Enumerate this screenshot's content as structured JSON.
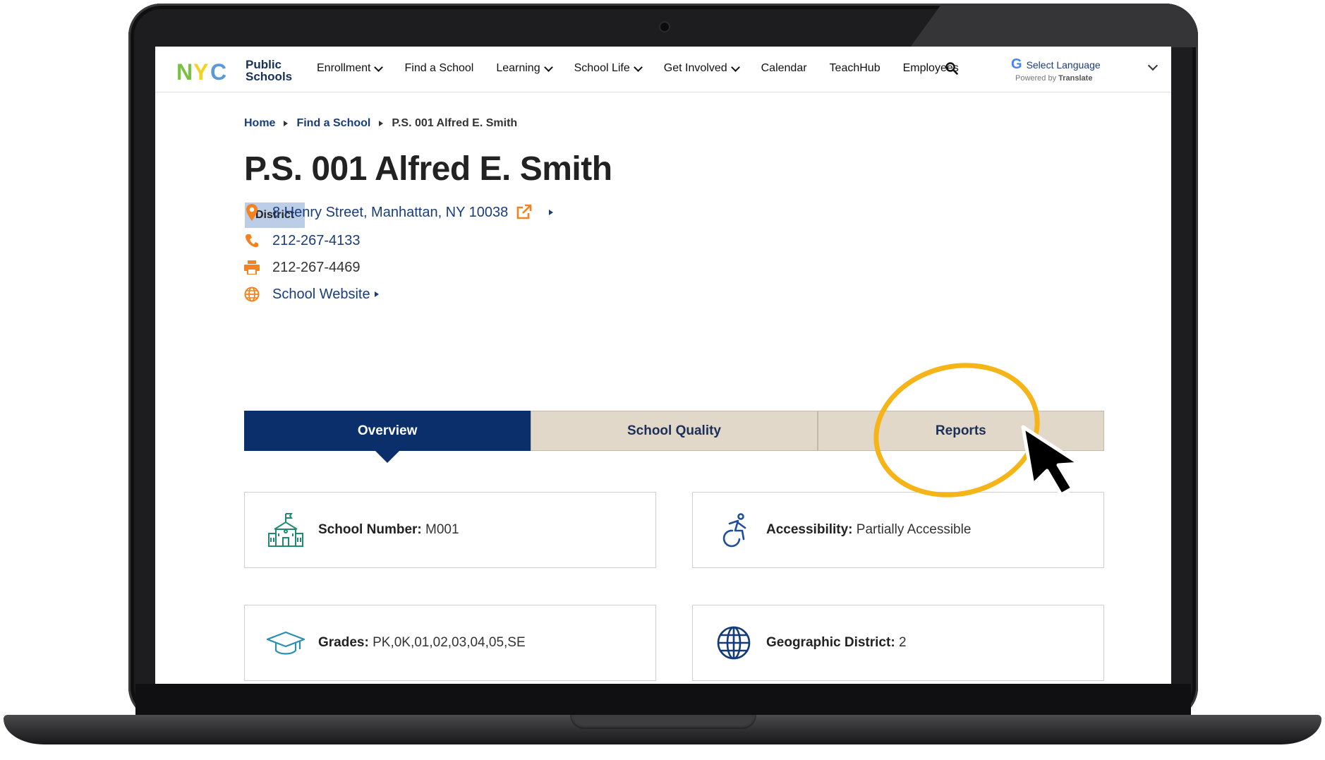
{
  "header": {
    "logo": {
      "mark": "NYC",
      "line1": "Public",
      "line2": "Schools"
    },
    "nav": [
      {
        "label": "Enrollment",
        "dropdown": true
      },
      {
        "label": "Find a School",
        "dropdown": false
      },
      {
        "label": "Learning",
        "dropdown": true
      },
      {
        "label": "School Life",
        "dropdown": true
      },
      {
        "label": "Get Involved",
        "dropdown": true
      },
      {
        "label": "Calendar",
        "dropdown": false
      },
      {
        "label": "TeachHub",
        "dropdown": false
      },
      {
        "label": "Employees",
        "dropdown": false
      }
    ],
    "search_icon": "search-icon",
    "language": {
      "g": "G",
      "label": "Select Language",
      "powered_prefix": "Powered by",
      "powered_brand": "Translate"
    }
  },
  "breadcrumb": {
    "home": "Home",
    "find": "Find a School",
    "current": "P.S. 001 Alfred E. Smith"
  },
  "school": {
    "name": "P.S. 001 Alfred E. Smith",
    "badge": "District",
    "address": "8 Henry Street, Manhattan, NY 10038",
    "phone": "212-267-4133",
    "fax": "212-267-4469",
    "website": "School Website"
  },
  "tabs": {
    "overview": "Overview",
    "quality": "School Quality",
    "reports": "Reports",
    "active": "Overview"
  },
  "cards": {
    "school_number": {
      "label": "School Number:",
      "value": "M001"
    },
    "accessibility": {
      "label": "Accessibility:",
      "value": "Partially Accessible"
    },
    "grades": {
      "label": "Grades:",
      "value": "PK,0K,01,02,03,04,05,SE"
    },
    "district": {
      "label": "Geographic District:",
      "value": "2"
    }
  },
  "colors": {
    "nav_blue": "#0a2f6b",
    "link_blue": "#1a3d7a",
    "tab_beige": "#e2d8c9",
    "badge_blue": "#bccde8",
    "accent_orange": "#f5821f",
    "highlight_circle": "#f5b417"
  }
}
